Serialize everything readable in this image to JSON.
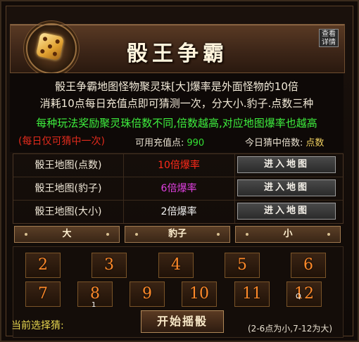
{
  "header": {
    "title": "骰王争霸",
    "help_label": "查看\n详情"
  },
  "description": {
    "line1": "骰王争霸地图怪物聚灵珠[大]爆率是外面怪物的10倍",
    "line2": "消耗10点每日充值点即可猜测一次，分大小.豹子.点数三种",
    "line3": "每种玩法奖励聚灵珠倍数不同,倍数越高,对应地图爆率也越高",
    "limit": "(每日仅可猜中一次)",
    "points_label": "可用充值点:",
    "points_value": "990",
    "guess_label": "今日猜中倍数:",
    "guess_value": "点数"
  },
  "maps": [
    {
      "name": "骰王地图(点数)",
      "rate": "10倍爆率",
      "rate_color": "#ff2a1a",
      "button": "进入地图"
    },
    {
      "name": "骰王地图(豹子)",
      "rate": "6倍爆率",
      "rate_color": "#e040e0",
      "button": "进入地图"
    },
    {
      "name": "骰王地图(大小)",
      "rate": "2倍爆率",
      "rate_color": "#f0f0f0",
      "button": "进入地图"
    }
  ],
  "bet_types": {
    "big": "大",
    "triple": "豹子",
    "small": "小"
  },
  "numbers": [
    "2",
    "3",
    "4",
    "5",
    "6",
    "7",
    "8",
    "9",
    "10",
    "11",
    "12"
  ],
  "markers": {
    "under_8": "1",
    "under_12": "Q"
  },
  "footer": {
    "current_label": "当前选择猜:",
    "start_button": "开始摇骰",
    "range_hint": "(2-6点为小,7-12为大)"
  }
}
